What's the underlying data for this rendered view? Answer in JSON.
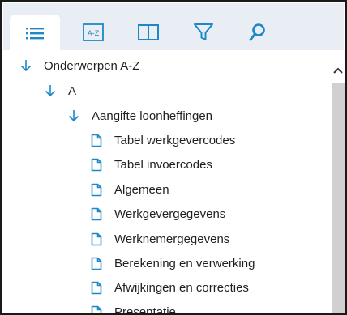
{
  "colors": {
    "accent": "#1e88c7",
    "tabbar_bg": "#e8eef3",
    "scroll_thumb": "#d0d0d0"
  },
  "tabs": [
    {
      "icon": "list-icon",
      "active": true
    },
    {
      "icon": "a-z-index-icon",
      "label": "A-Z",
      "active": false
    },
    {
      "icon": "book-icon",
      "active": false
    },
    {
      "icon": "filter-icon",
      "active": false
    },
    {
      "icon": "search-icon",
      "active": false
    }
  ],
  "tree": {
    "root": {
      "label": "Onderwerpen A-Z",
      "icon": "expanded-arrow-icon"
    },
    "letter": {
      "label": "A",
      "icon": "expanded-arrow-icon"
    },
    "topic": {
      "label": "Aangifte loonheffingen",
      "icon": "expanded-arrow-icon"
    },
    "pages": [
      {
        "label": "Tabel werkgevercodes",
        "icon": "document-icon"
      },
      {
        "label": "Tabel invoercodes",
        "icon": "document-icon"
      },
      {
        "label": "Algemeen",
        "icon": "document-icon"
      },
      {
        "label": "Werkgevergegevens",
        "icon": "document-icon"
      },
      {
        "label": "Werknemergegevens",
        "icon": "document-icon"
      },
      {
        "label": "Berekening en verwerking",
        "icon": "document-icon"
      },
      {
        "label": "Afwijkingen en correcties",
        "icon": "document-icon"
      },
      {
        "label": "Presentatie",
        "icon": "document-icon"
      }
    ]
  },
  "scrollbar": {
    "up_icon": "chevron-up-icon"
  }
}
